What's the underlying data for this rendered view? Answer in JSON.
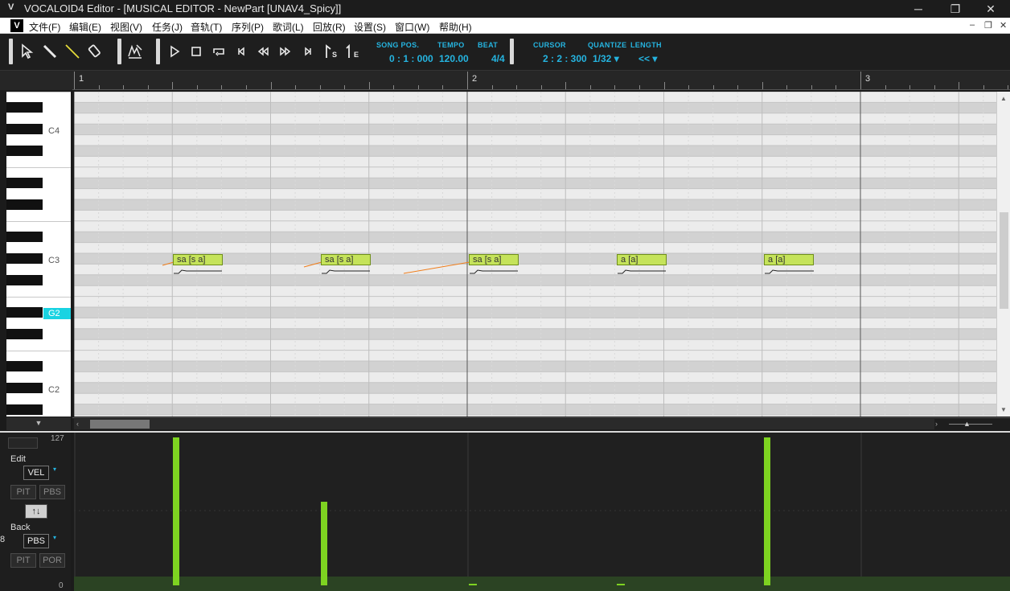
{
  "window": {
    "logo": "V",
    "title": "VOCALOID4 Editor - [MUSICAL EDITOR - NewPart [UNAV4_Spicy]]",
    "minimize": "─",
    "restore": "❐",
    "close": "✕"
  },
  "menu": {
    "logo": "V",
    "items": [
      "文件(F)",
      "编辑(E)",
      "视图(V)",
      "任务(J)",
      "音轨(T)",
      "序列(P)",
      "歌词(L)",
      "回放(R)",
      "设置(S)",
      "窗口(W)",
      "帮助(H)"
    ],
    "mdi_min": "‒",
    "mdi_restore": "❐",
    "mdi_close": "✕"
  },
  "toolbar": {
    "tools": [
      "arrow-tool",
      "pencil-tool",
      "line-tool",
      "eraser-tool",
      "vibrato-tool"
    ],
    "transport": [
      "play",
      "stop",
      "loop",
      "go-start",
      "rewind",
      "fast-forward",
      "go-end",
      "start-marker",
      "end-marker"
    ],
    "song_pos_label": "SONG POS.",
    "song_pos_value": "0 : 1 : 000",
    "tempo_label": "TEMPO",
    "tempo_value": "120.00",
    "beat_label": "BEAT",
    "beat_value": "4/4",
    "cursor_label": "CURSOR",
    "cursor_value": "2 : 2 : 300",
    "quantize_label": "QUANTIZE",
    "quantize_value": "1/32 ▾",
    "length_label": "LENGTH",
    "length_value": "<< ▾",
    "start_marker_sub": "S",
    "end_marker_sub": "E"
  },
  "ruler": {
    "bars": [
      "1",
      "2",
      "3"
    ]
  },
  "keyboard": {
    "labels": [
      "C4",
      "C3",
      "C2"
    ],
    "highlighted": "G2",
    "menu_arrow": "▼"
  },
  "notes": [
    {
      "lyric": "sa",
      "phoneme": "[s a]",
      "pitch": "C3"
    },
    {
      "lyric": "sa",
      "phoneme": "[s a]",
      "pitch": "C3"
    },
    {
      "lyric": "sa",
      "phoneme": "[s a]",
      "pitch": "C3"
    },
    {
      "lyric": "a",
      "phoneme": "[a]",
      "pitch": "C3"
    },
    {
      "lyric": "a",
      "phoneme": "[a]",
      "pitch": "C3"
    }
  ],
  "control": {
    "max_value": "127",
    "min_value": "0",
    "edit_label": "Edit",
    "edit_param": "VEL",
    "edit_buttons": [
      "PIT",
      "PBS"
    ],
    "swap_button": "↑↓",
    "back_label": "Back",
    "back_param": "PBS",
    "back_buttons": [
      "PIT",
      "POR"
    ],
    "side_number": "8",
    "velocities": [
      127,
      72,
      0,
      0,
      127
    ]
  },
  "colors": {
    "accent": "#25b4e0",
    "note_fill": "#c5e35a",
    "velocity": "#7ed321",
    "pitch_line": "#f07d1a",
    "highlight_key": "#19d3e2"
  }
}
